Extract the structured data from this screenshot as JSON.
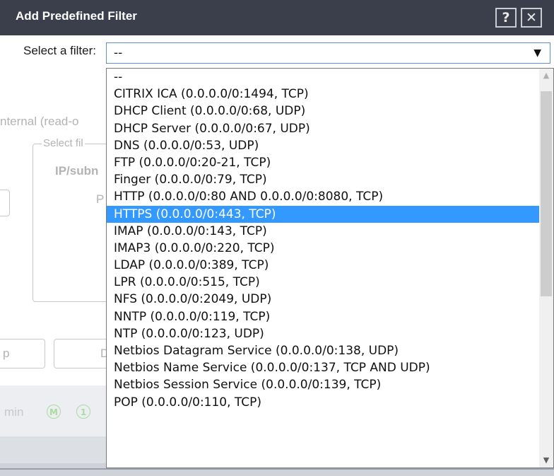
{
  "dialog": {
    "title": "Add Predefined Filter",
    "help_glyph": "?",
    "close_glyph": "✕"
  },
  "filter": {
    "label": "Select a filter:",
    "value": "--",
    "arrow_glyph": "▼"
  },
  "background": {
    "internal_text": "nternal (read-o",
    "select_fil_text": "Select fil",
    "ip_subnet_text": "IP/subn",
    "p_text": "P",
    "p_button_text": "p",
    "d_button_text": "D",
    "admin_text": "min",
    "badge_m": "M",
    "badge_1": "1"
  },
  "options": [
    "--",
    "CITRIX ICA (0.0.0.0/0:1494, TCP)",
    "DHCP Client (0.0.0.0/0:68, UDP)",
    "DHCP Server (0.0.0.0/0:67, UDP)",
    "DNS (0.0.0.0/0:53, UDP)",
    "FTP (0.0.0.0/0:20-21, TCP)",
    "Finger (0.0.0.0/0:79, TCP)",
    "HTTP (0.0.0.0/0:80 AND 0.0.0.0/0:8080, TCP)",
    "HTTPS (0.0.0.0/0:443, TCP)",
    "IMAP (0.0.0.0/0:143, TCP)",
    "IMAP3 (0.0.0.0/0:220, TCP)",
    "LDAP (0.0.0.0/0:389, TCP)",
    "LPR (0.0.0.0/0:515, TCP)",
    "NFS (0.0.0.0/0:2049, UDP)",
    "NNTP (0.0.0.0/0:119, TCP)",
    "NTP (0.0.0.0/0:123, UDP)",
    "Netbios Datagram Service (0.0.0.0/0:138, UDP)",
    "Netbios Name Service (0.0.0.0/0:137, TCP AND UDP)",
    "Netbios Session Service (0.0.0.0/0:139, TCP)",
    "POP (0.0.0.0/0:110, TCP)"
  ],
  "selected_index": 8,
  "scrollbar": {
    "up_glyph": "▲",
    "down_glyph": "▼"
  },
  "colors": {
    "titlebar": "#3a3f4b",
    "selection": "#3399ff",
    "select_border": "#5a8fd8"
  }
}
